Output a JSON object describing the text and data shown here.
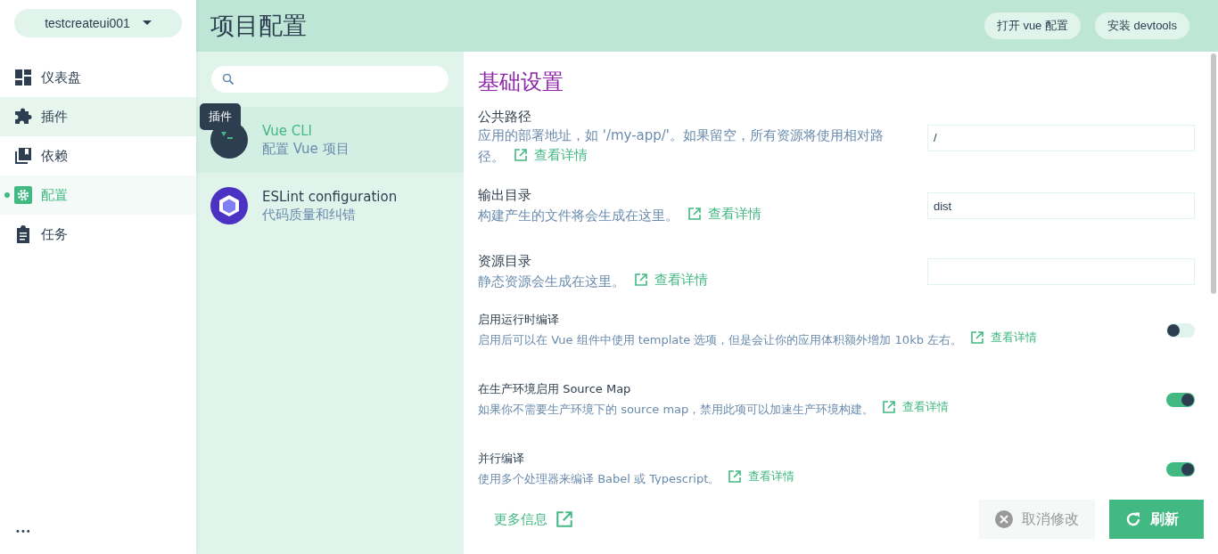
{
  "project_selector": {
    "label": "testcreateui001"
  },
  "nav": [
    {
      "label": "仪表盘",
      "selected": false,
      "hovered": false
    },
    {
      "label": "插件",
      "selected": false,
      "hovered": true
    },
    {
      "label": "依赖",
      "selected": false,
      "hovered": false
    },
    {
      "label": "配置",
      "selected": true,
      "hovered": false
    },
    {
      "label": "任务",
      "selected": false,
      "hovered": false
    }
  ],
  "more_label": "•••",
  "header": {
    "title": "项目配置",
    "buttons": [
      "打开 vue 配置",
      "安装 devtools"
    ]
  },
  "configs": [
    {
      "name": "Vue CLI",
      "description": "配置 Vue 项目",
      "selected": true
    },
    {
      "name": "ESLint configuration",
      "description": "代码质量和纠错",
      "selected": false
    }
  ],
  "tooltip": {
    "text": "插件"
  },
  "section_title": "基础设置",
  "settings": [
    {
      "kind": "input",
      "label": "公共路径",
      "description": "应用的部署地址，如 '/my-app/'。如果留空，所有资源将使用相对路径。",
      "link": "查看详情",
      "value": "/"
    },
    {
      "kind": "input",
      "label": "输出目录",
      "description": "构建产生的文件将会生成在这里。",
      "link": "查看详情",
      "value": "dist"
    },
    {
      "kind": "input",
      "label": "资源目录",
      "description": "静态资源会生成在这里。",
      "link": "查看详情"
    },
    {
      "kind": "switch",
      "label": "启用运行时编译",
      "description": "启用后可以在 Vue 组件中使用 template 选项，但是会让你的应用体积额外增加 10kb 左右。",
      "link": "查看详情",
      "on": false
    },
    {
      "kind": "switch",
      "label": "在生产环境启用 Source Map",
      "description": "如果你不需要生产环境下的 source map，禁用此项可以加速生产环境构建。",
      "link": "查看详情",
      "on": true
    },
    {
      "kind": "switch",
      "label": "并行编译",
      "description": "使用多个处理器来编译 Babel 或 Typescript。",
      "link": "查看详情",
      "on": true
    }
  ],
  "footer": {
    "more_info": "更多信息",
    "cancel": {
      "label": "取消修改",
      "disabled": true
    },
    "refresh": {
      "label": "刷新",
      "disabled": false
    }
  }
}
